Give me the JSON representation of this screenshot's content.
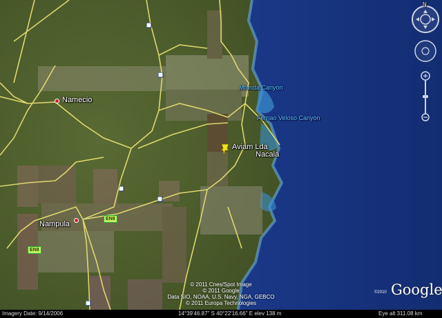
{
  "places": {
    "namecio": "Namecio",
    "nampula": "Nampula",
    "aviam": "Aviam Lda",
    "nacala": "Nacala"
  },
  "undersea": {
    "canyon1": "Mtunda Canyon",
    "canyon2": "Fernao Veloso Canyon"
  },
  "roads": {
    "en8_a": "EN8",
    "en8_b": "EN8"
  },
  "copyright": {
    "line1": "© 2011 Cnes/Spot Image",
    "line2": "© 2011 Google",
    "line3": "Data SIO, NOAA, U.S. Navy, NGA, GEBCO",
    "line4": "© 2011 Europa Technologies"
  },
  "status": {
    "imagery_date": "Imagery Date: 9/14/2006",
    "coordinates": "14°39'46.87\" S   40°22'16.66\" E  elev  138 m",
    "eye_alt": "Eye alt   311.08 km"
  },
  "logo": {
    "text": "Google",
    "year": "©2010"
  },
  "nav": {
    "north": "N"
  },
  "colors": {
    "land": "#4a5a2c",
    "ocean": "#1a3a8a",
    "road": "#e8e070",
    "label_water": "#5cc4ff",
    "pin": "#f5e21a"
  }
}
